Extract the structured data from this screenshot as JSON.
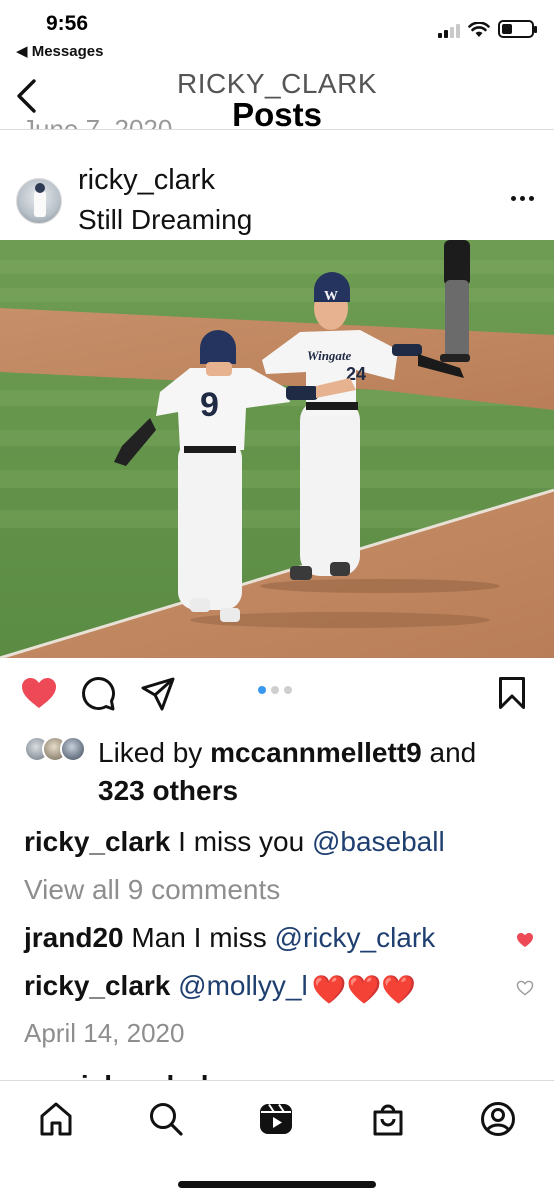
{
  "status_bar": {
    "time": "9:56",
    "back_label": "◀ Messages",
    "battery_level": 0.35,
    "signal_bars": 2
  },
  "header": {
    "username": "RICKY_CLARK",
    "title": "Posts",
    "previous_post_date": "June 7, 2020"
  },
  "post": {
    "username": "ricky_clark",
    "location_caption": "Still Dreaming",
    "photo": {
      "player_front_number": "9",
      "player_back_jersey_text": "Wingate",
      "player_back_number": "24",
      "helmet_letter": "W"
    },
    "carousel": {
      "count": 3,
      "active_index": 0
    },
    "liked": true,
    "likes": {
      "prefix": "Liked by ",
      "liker": "mccannmellett9",
      "middle": " and",
      "others": "323 others"
    },
    "caption": {
      "username": "ricky_clark",
      "text": " I miss you ",
      "mention": "@baseball"
    },
    "view_comments": "View all 9 comments",
    "comments": [
      {
        "username": "jrand20",
        "text": " Man I miss ",
        "mention": "@ricky_clark",
        "liked": true
      },
      {
        "username": "ricky_clark",
        "text": " ",
        "mention": "@mollyy_l",
        "hearts": "❤️❤️❤️",
        "liked": false
      }
    ],
    "date": "April 14, 2020",
    "next_post_username": "ricky_clark"
  },
  "colors": {
    "like_red": "#ed4956",
    "mention_blue": "#1f3f70",
    "muted_gray": "#8e8e8e",
    "dot_active": "#3897f0"
  },
  "bottom_nav": [
    "home-icon",
    "search-icon",
    "reels-icon",
    "shop-icon",
    "profile-icon"
  ]
}
